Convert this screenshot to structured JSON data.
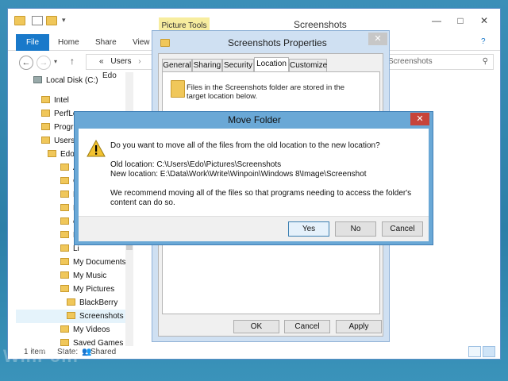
{
  "explorer": {
    "title": "Screenshots",
    "contextual_tab": "Picture Tools",
    "ribbon_tabs": [
      "File",
      "Home",
      "Share",
      "View"
    ],
    "address": {
      "prefix": "«",
      "crumb1": "Users",
      "crumb2": "Edo"
    },
    "search_text": "Screenshots",
    "tree": [
      {
        "label": "Local Disk (C:)"
      },
      {
        "label": "Intel"
      },
      {
        "label": "PerfLogs"
      },
      {
        "label": "Progr"
      },
      {
        "label": "Users"
      },
      {
        "label": "Edo"
      },
      {
        "label": "Ad"
      },
      {
        "label": "Co"
      },
      {
        "label": "De"
      },
      {
        "label": "Do"
      },
      {
        "label": "ea"
      },
      {
        "label": "Fa"
      },
      {
        "label": "Li"
      },
      {
        "label": "My Documents"
      },
      {
        "label": "My Music"
      },
      {
        "label": "My Pictures"
      },
      {
        "label": "BlackBerry"
      },
      {
        "label": "Screenshots"
      },
      {
        "label": "My Videos"
      },
      {
        "label": "Saved Games"
      }
    ],
    "status": {
      "items": "1 item",
      "state_label": "State:",
      "state_value": "Shared"
    }
  },
  "properties": {
    "title": "Screenshots Properties",
    "tabs": [
      "General",
      "Sharing",
      "Security",
      "Location",
      "Customize"
    ],
    "active_tab": "Location",
    "location_text": "Files in the Screenshots folder are stored in the target location below.",
    "buttons": {
      "ok": "OK",
      "cancel": "Cancel",
      "apply": "Apply"
    }
  },
  "move_folder": {
    "title": "Move Folder",
    "question": "Do you want to move all of the files from the old location to the new location?",
    "old_location": "Old location: C:\\Users\\Edo\\Pictures\\Screenshots",
    "new_location": "New location: E:\\Data\\Work\\Write\\Winpoin\\Windows 8\\Image\\Screenshot",
    "recommend_line1": "We recommend moving all of the files so that programs needing to access the folder's",
    "recommend_line2": "content can do so.",
    "buttons": {
      "yes": "Yes",
      "no": "No",
      "cancel": "Cancel"
    }
  },
  "watermark": "WinPoin",
  "colors": {
    "desktop": "#3b8fb8",
    "file_tab": "#1979ca",
    "picture_tools": "#f7ed9f",
    "dialog_frame": "#6aa8d6",
    "close_red": "#c7443a"
  }
}
